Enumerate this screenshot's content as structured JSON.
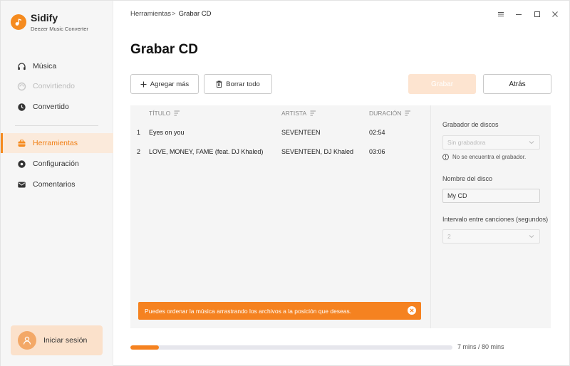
{
  "app": {
    "name": "Sidify",
    "subtitle": "Deezer Music Converter",
    "accent": "#f58220"
  },
  "sidebar": {
    "items": [
      {
        "label": "Música",
        "icon": "headphones-icon",
        "state": "normal"
      },
      {
        "label": "Convirtiendo",
        "icon": "sync-icon",
        "state": "disabled"
      },
      {
        "label": "Convertido",
        "icon": "clock-icon",
        "state": "normal"
      },
      {
        "label": "Herramientas",
        "icon": "toolbox-icon",
        "state": "active"
      },
      {
        "label": "Configuración",
        "icon": "gear-icon",
        "state": "normal"
      },
      {
        "label": "Comentarios",
        "icon": "mail-icon",
        "state": "normal"
      }
    ],
    "login_label": "Iniciar sesión"
  },
  "breadcrumb": {
    "parent": "Herramientas",
    "separator": ">",
    "current": "Grabar CD"
  },
  "page": {
    "title": "Grabar CD"
  },
  "toolbar": {
    "add_label": "Agregar más",
    "clear_label": "Borrar todo",
    "burn_label": "Grabar",
    "back_label": "Atrás"
  },
  "table": {
    "columns": [
      "TÍTULO",
      "ARTISTA",
      "DURACIÓN"
    ],
    "rows": [
      {
        "num": "1",
        "title": "Eyes on you",
        "artist": "SEVENTEEN",
        "duration": "02:54"
      },
      {
        "num": "2",
        "title": "LOVE, MONEY, FAME (feat. DJ Khaled)",
        "artist": "SEVENTEEN, DJ Khaled",
        "duration": "03:06"
      }
    ]
  },
  "toast": {
    "message": "Puedes ordenar la música arrastrando los archivos a la posición que deseas."
  },
  "settings": {
    "burner_label": "Grabador de discos",
    "burner_value": "Sin grabadora",
    "burner_warning": "No se encuentra el grabador.",
    "disc_name_label": "Nombre del disco",
    "disc_name_value": "My CD",
    "interval_label": "Intervalo entre canciones (segundos)",
    "interval_value": "2"
  },
  "progress": {
    "fraction": 0.0875,
    "text": "7 mins / 80 mins"
  }
}
